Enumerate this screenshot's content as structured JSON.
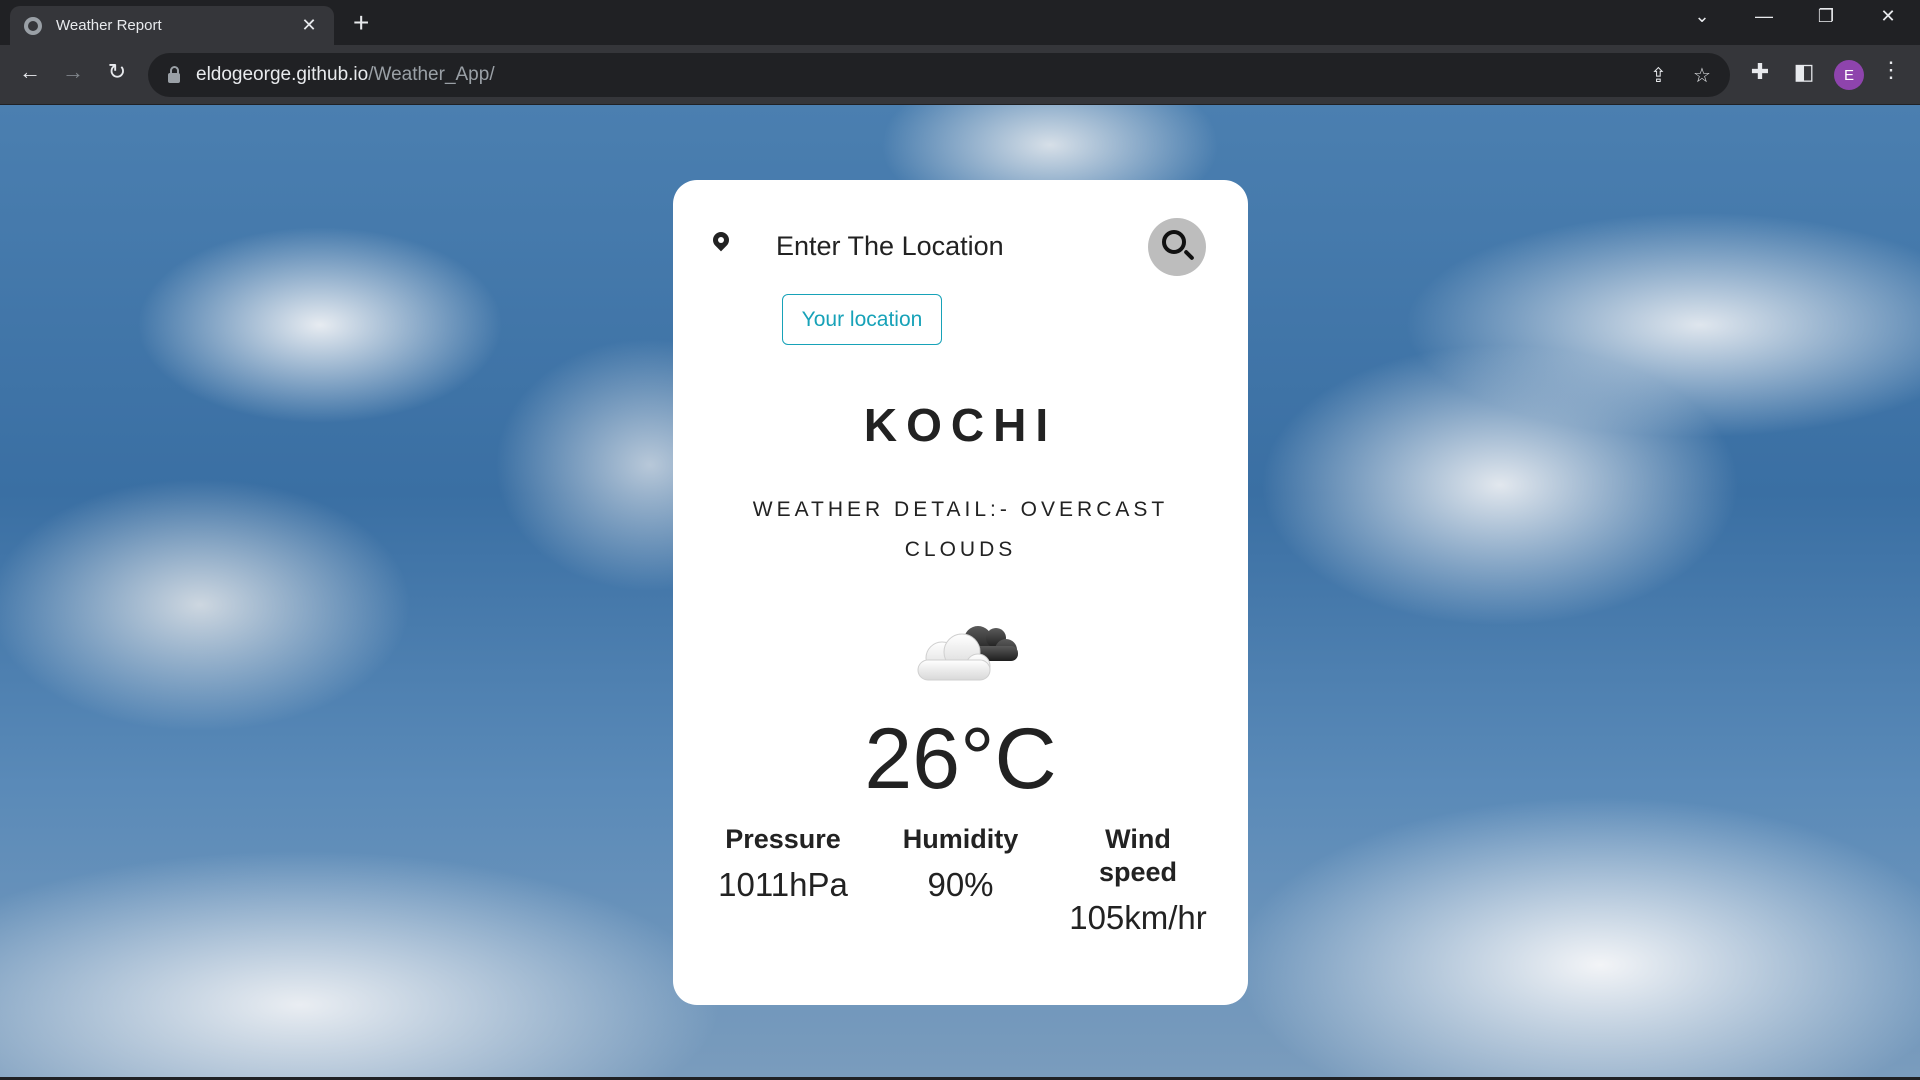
{
  "browser": {
    "tab_title": "Weather Report",
    "tab_close": "✕",
    "new_tab": "+",
    "url_host": "eldogeorge.github.io",
    "url_path": "/Weather_App/",
    "avatar_initial": "E",
    "icons": {
      "back": "back-arrow-icon",
      "forward": "forward-arrow-icon",
      "reload": "reload-icon",
      "share": "share-icon",
      "bookmark": "star-icon",
      "extensions": "puzzle-icon",
      "side_panel": "side-panel-icon",
      "menu": "kebab-menu-icon"
    },
    "avatar_color": "#8e44ad"
  },
  "app": {
    "search": {
      "placeholder": "Enter The Location",
      "value": ""
    },
    "your_location_label": "Your location",
    "city": "KOCHI",
    "weather_detail": "WEATHER DETAIL:- OVERCAST CLOUDS",
    "weather_icon": "overcast-cloud-icon",
    "temperature": "26°C",
    "stats": [
      {
        "label": "Pressure",
        "value": "1011hPa"
      },
      {
        "label": "Humidity",
        "value": "90%"
      },
      {
        "label": "Wind speed",
        "value": "105km/hr"
      }
    ],
    "accent_color": "#17a2b8"
  }
}
